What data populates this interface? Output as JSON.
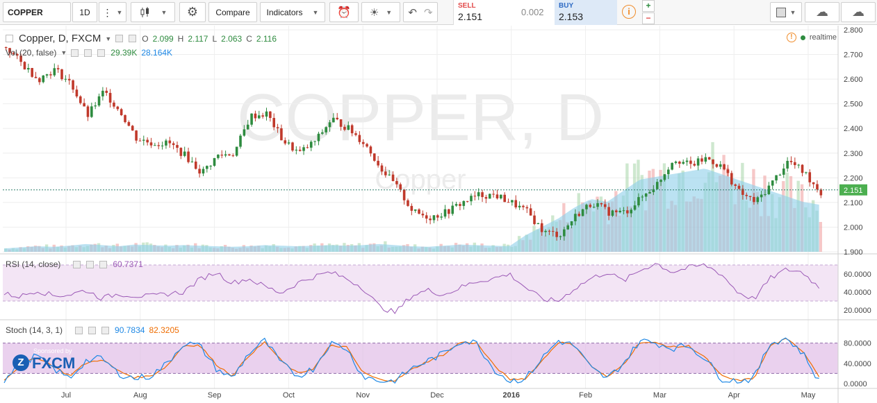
{
  "toolbar": {
    "symbol": "COPPER",
    "interval": "1D",
    "compare_label": "Compare",
    "indicators_label": "Indicators"
  },
  "trade": {
    "sell_label": "SELL",
    "sell_price": "2.151",
    "spread": "0.002",
    "buy_label": "BUY",
    "buy_price": "2.153"
  },
  "main_legend": {
    "title": "Copper, D, FXCM",
    "o_label": "O",
    "o": "2.099",
    "h_label": "H",
    "h": "2.117",
    "l_label": "L",
    "l": "2.063",
    "c_label": "C",
    "c": "2.116",
    "realtime": "realtime"
  },
  "vol_legend": {
    "title": "Vol (20, false)",
    "v1": "29.39K",
    "v2": "28.164K"
  },
  "rsi_legend": {
    "title": "RSI (14, close)",
    "value": "60.7371"
  },
  "stoch_legend": {
    "title": "Stoch (14, 3, 1)",
    "k": "90.7834",
    "d": "82.3205"
  },
  "watermark": {
    "title": "COPPER, D",
    "subtitle": "Copper"
  },
  "sponsor": {
    "label": "Sponsored by",
    "brand": "FXCM"
  },
  "colors": {
    "up": "#2e8b3f",
    "down": "#c0392b",
    "rsi": "#9b59b6",
    "stoch_k": "#1e88e5",
    "stoch_d": "#ef6c00",
    "price_tag": "#4caf50",
    "vol_ma": "#8ecfe9"
  },
  "chart_data": {
    "type": "candlestick",
    "price_axis": [
      "2.800",
      "2.700",
      "2.600",
      "2.500",
      "2.400",
      "2.300",
      "2.200",
      "2.100",
      "2.000",
      "1.900"
    ],
    "price_ylim": [
      1.9,
      2.8
    ],
    "last_price": "2.151",
    "x_labels": [
      "Jul",
      "Aug",
      "Sep",
      "Oct",
      "Nov",
      "Dec",
      "2016",
      "Feb",
      "Mar",
      "Apr",
      "May"
    ],
    "close_path": [
      2.73,
      2.66,
      2.6,
      2.64,
      2.58,
      2.45,
      2.55,
      2.47,
      2.36,
      2.34,
      2.34,
      2.29,
      2.22,
      2.29,
      2.3,
      2.45,
      2.46,
      2.35,
      2.3,
      2.35,
      2.44,
      2.4,
      2.34,
      2.24,
      2.16,
      2.06,
      2.04,
      2.06,
      2.1,
      2.13,
      2.13,
      2.1,
      2.06,
      1.98,
      1.97,
      2.05,
      2.1,
      2.06,
      2.06,
      2.12,
      2.18,
      2.28,
      2.25,
      2.28,
      2.24,
      2.14,
      2.1,
      2.18,
      2.27,
      2.22,
      2.14
    ],
    "rsi_axis": [
      "60.0000",
      "40.0000",
      "20.0000"
    ],
    "rsi_ylim": [
      10,
      80
    ],
    "rsi_path": [
      38,
      35,
      42,
      36,
      37,
      42,
      33,
      38,
      36,
      35,
      38,
      40,
      54,
      62,
      50,
      55,
      46,
      39,
      50,
      57,
      62,
      55,
      45,
      24,
      17,
      36,
      42,
      37,
      45,
      52,
      55,
      60,
      45,
      32,
      30,
      44,
      55,
      62,
      52,
      64,
      72,
      62,
      67,
      70,
      60,
      40,
      32,
      55,
      65,
      62,
      45
    ],
    "stoch_axis": [
      "80.0000",
      "40.0000",
      "0.0000"
    ],
    "stoch_ylim": [
      0,
      100
    ],
    "stoch_k_path": [
      5,
      40,
      55,
      30,
      10,
      45,
      50,
      20,
      10,
      15,
      40,
      80,
      75,
      30,
      10,
      60,
      85,
      40,
      15,
      30,
      80,
      70,
      15,
      5,
      5,
      30,
      45,
      60,
      85,
      80,
      30,
      5,
      10,
      50,
      85,
      75,
      30,
      10,
      40,
      85,
      80,
      70,
      75,
      50,
      10,
      5,
      10,
      80,
      90,
      60,
      5
    ],
    "stoch_d_path": [
      8,
      35,
      52,
      35,
      15,
      40,
      48,
      25,
      12,
      15,
      35,
      75,
      76,
      38,
      15,
      55,
      82,
      45,
      20,
      30,
      75,
      72,
      22,
      8,
      6,
      28,
      44,
      58,
      82,
      80,
      38,
      8,
      10,
      45,
      82,
      76,
      35,
      12,
      38,
      82,
      80,
      72,
      74,
      52,
      15,
      6,
      10,
      75,
      88,
      65,
      15
    ],
    "volume_path": [
      6,
      8,
      10,
      9,
      11,
      14,
      12,
      10,
      13,
      12,
      11,
      12,
      11,
      10,
      9,
      10,
      12,
      11,
      10,
      11,
      12,
      11,
      12,
      14,
      12,
      10,
      9,
      11,
      13,
      12,
      11,
      10,
      30,
      45,
      60,
      80,
      95,
      90,
      110,
      130,
      135,
      140,
      145,
      150,
      140,
      130,
      120,
      110,
      100,
      90,
      85
    ],
    "volume_ylim": [
      0,
      200
    ]
  }
}
